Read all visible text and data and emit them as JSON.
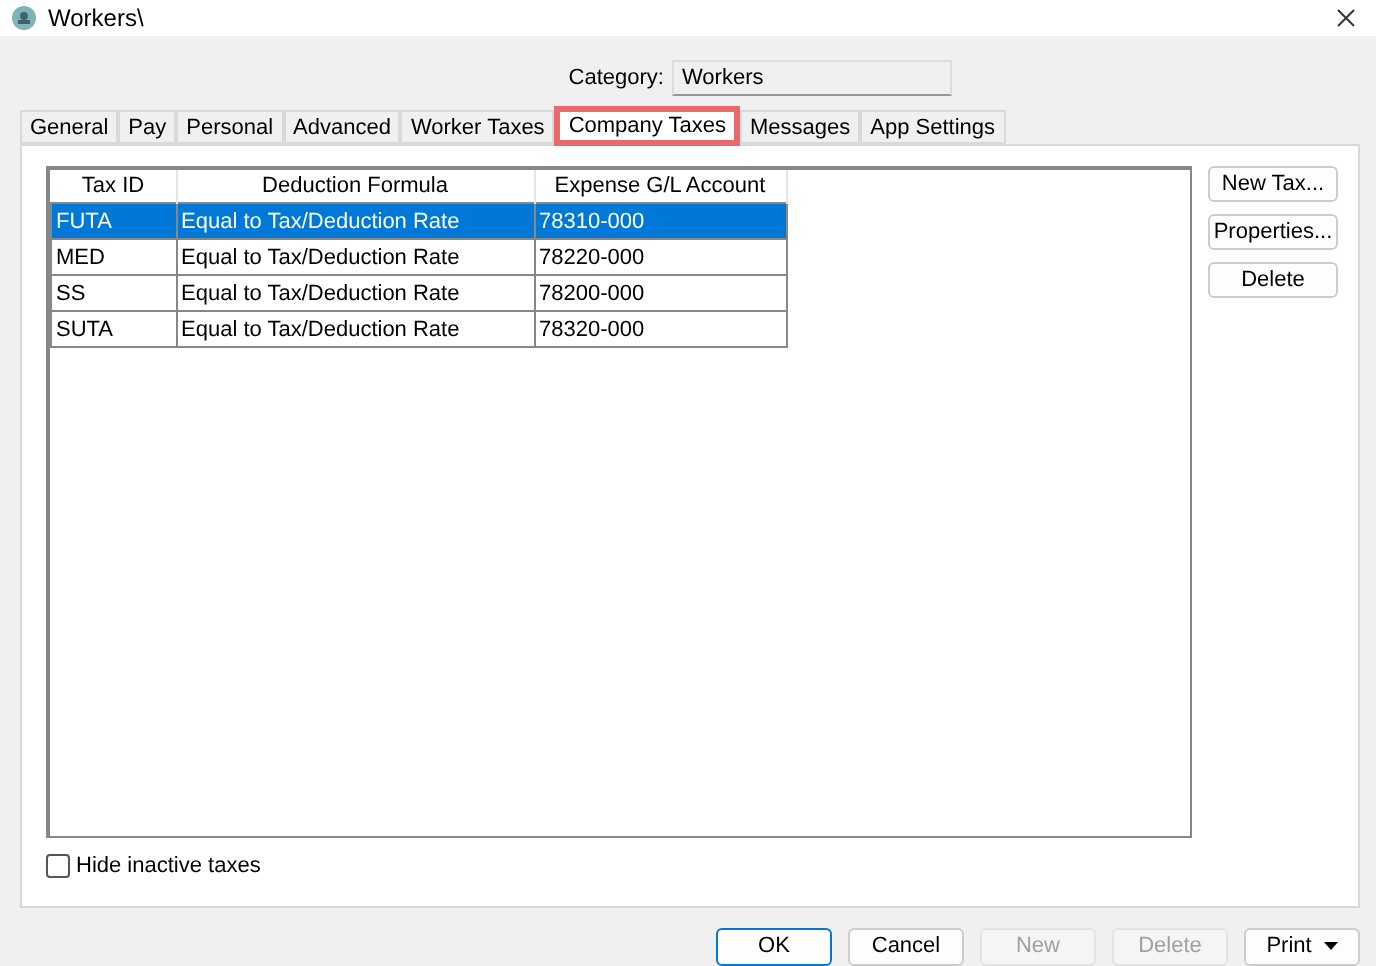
{
  "window": {
    "title": "Workers\\"
  },
  "category": {
    "label": "Category:",
    "value": "Workers"
  },
  "tabs": [
    {
      "label": "General",
      "selected": false,
      "highlighted": false
    },
    {
      "label": "Pay",
      "selected": false,
      "highlighted": false
    },
    {
      "label": "Personal",
      "selected": false,
      "highlighted": false
    },
    {
      "label": "Advanced",
      "selected": false,
      "highlighted": false
    },
    {
      "label": "Worker Taxes",
      "selected": false,
      "highlighted": false
    },
    {
      "label": "Company Taxes",
      "selected": true,
      "highlighted": true
    },
    {
      "label": "Messages",
      "selected": false,
      "highlighted": false
    },
    {
      "label": "App Settings",
      "selected": false,
      "highlighted": false
    }
  ],
  "table": {
    "columns": [
      "Tax ID",
      "Deduction Formula",
      "Expense G/L Account"
    ],
    "rows": [
      {
        "cells": [
          "FUTA",
          "Equal to Tax/Deduction Rate",
          "78310-000"
        ],
        "selected": true
      },
      {
        "cells": [
          "MED",
          "Equal to Tax/Deduction Rate",
          "78220-000"
        ],
        "selected": false
      },
      {
        "cells": [
          "SS",
          "Equal to Tax/Deduction Rate",
          "78200-000"
        ],
        "selected": false
      },
      {
        "cells": [
          "SUTA",
          "Equal to Tax/Deduction Rate",
          "78320-000"
        ],
        "selected": false
      }
    ]
  },
  "side_buttons": [
    "New Tax...",
    "Properties...",
    "Delete"
  ],
  "hide_inactive": {
    "label": "Hide inactive taxes",
    "checked": false
  },
  "footer_buttons": [
    {
      "label": "OK",
      "disabled": false,
      "default": true,
      "kind": "plain"
    },
    {
      "label": "Cancel",
      "disabled": false,
      "default": false,
      "kind": "plain"
    },
    {
      "label": "New",
      "disabled": true,
      "default": false,
      "kind": "plain"
    },
    {
      "label": "Delete",
      "disabled": true,
      "default": false,
      "kind": "plain"
    },
    {
      "label": "Print",
      "disabled": false,
      "default": false,
      "kind": "dropdown"
    }
  ]
}
